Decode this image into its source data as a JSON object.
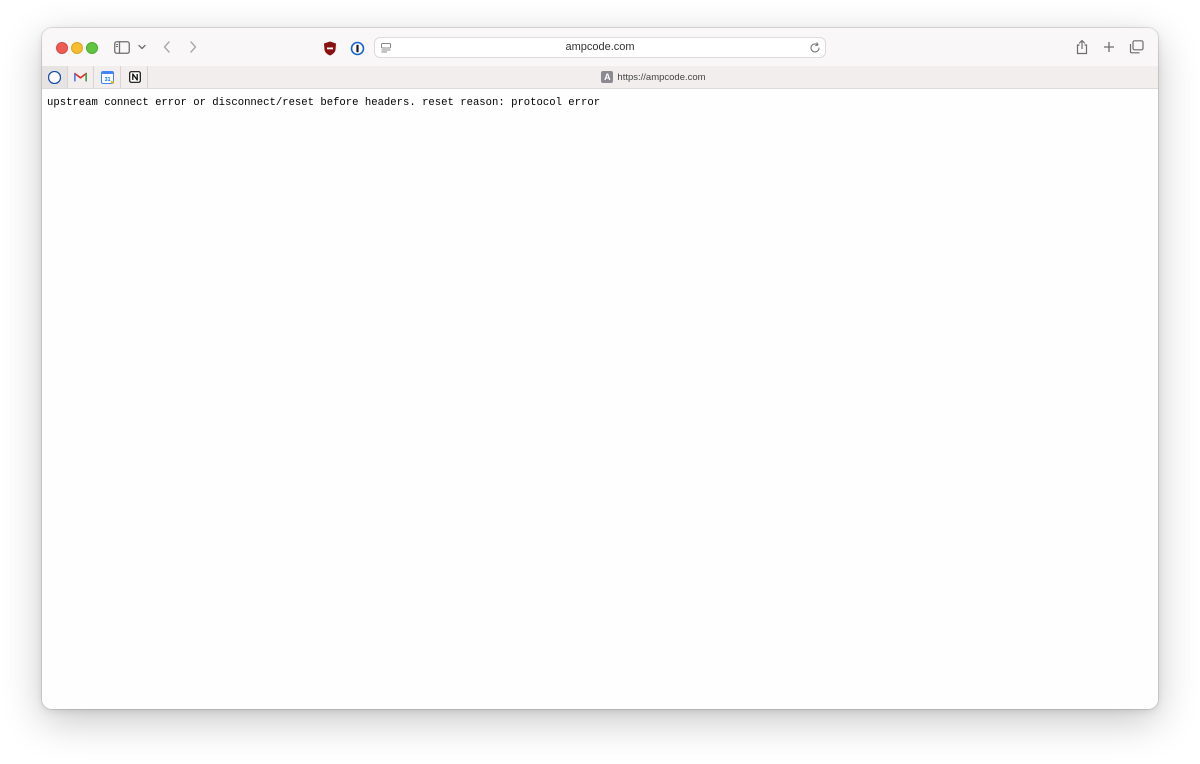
{
  "toolbar": {
    "address": "ampcode.com"
  },
  "tabstrip": {
    "pinned_tabs": [
      {
        "icon": "safari-compass-icon"
      },
      {
        "icon": "gmail-icon"
      },
      {
        "icon": "google-calendar-icon",
        "label": "31"
      },
      {
        "icon": "notion-icon"
      }
    ],
    "active_tab": {
      "favicon_letter": "A",
      "title": "https://ampcode.com"
    }
  },
  "page": {
    "error_message": "upstream connect error or disconnect/reset before headers. reset reason: protocol error"
  },
  "colors": {
    "close": "#ee5b55",
    "minimize": "#f5bd2f",
    "maximize": "#5fc53f",
    "toolbar_bg": "#f9f7f7"
  }
}
